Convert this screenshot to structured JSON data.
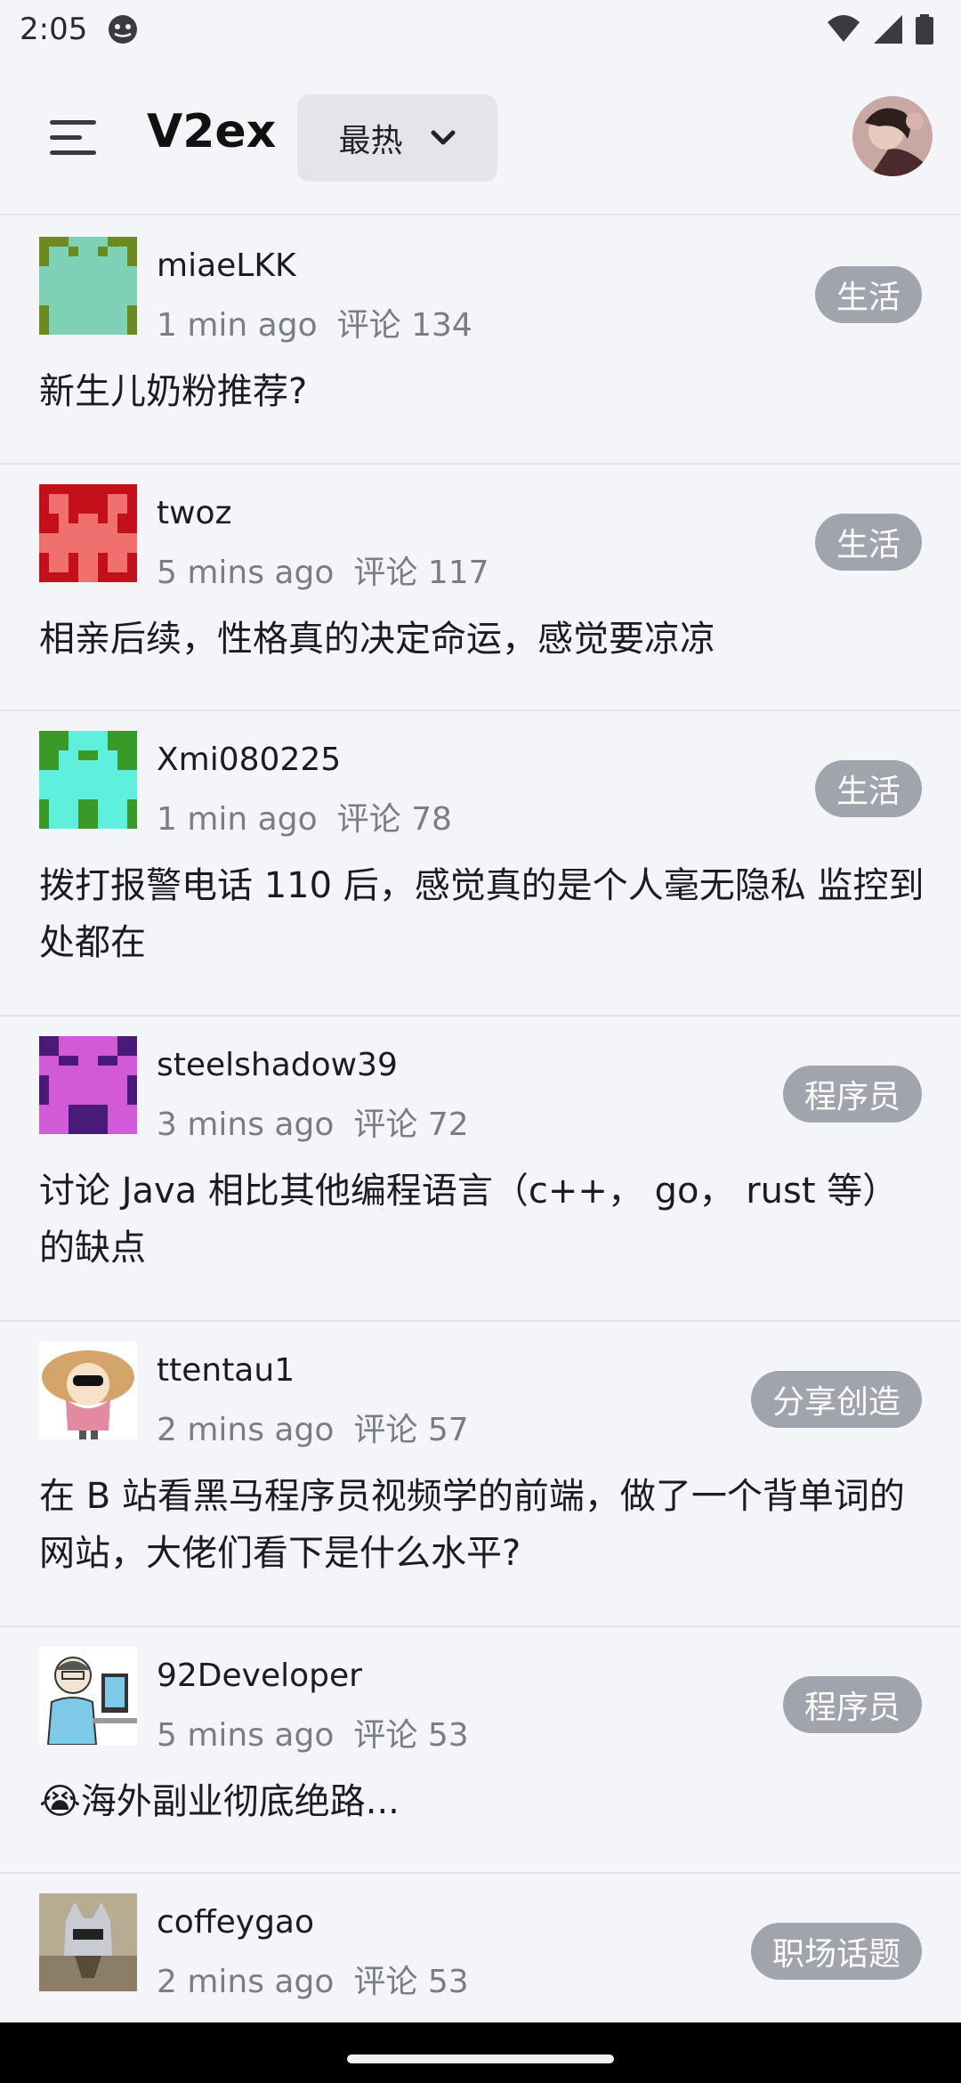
{
  "status_bar": {
    "time": "2:05",
    "icons": [
      "app-notification-icon",
      "wifi-icon",
      "signal-icon",
      "battery-icon"
    ]
  },
  "app_bar": {
    "title": "V2ex",
    "sort_label": "最热",
    "icons": [
      "menu-icon",
      "chevron-down-icon",
      "user-avatar"
    ]
  },
  "feed": [
    {
      "author": "miaeLKK",
      "time": "1 min ago",
      "comments": "评论 134",
      "node": "生活",
      "title": "新生儿奶粉推荐?",
      "avatar_color": "#6C8A1F",
      "avatar_fg": "#7ED1B5"
    },
    {
      "author": "twoz",
      "time": "5 mins ago",
      "comments": "评论 117",
      "node": "生活",
      "title": "相亲后续，性格真的决定命运，感觉要凉凉",
      "avatar_color": "#C4101A",
      "avatar_fg": "#F07070"
    },
    {
      "author": "Xmi080225",
      "time": "1 min ago",
      "comments": "评论 78",
      "node": "生活",
      "title": "拨打报警电话 110 后，感觉真的是个人毫无隐私 监控到处都在",
      "avatar_color": "#3A9A28",
      "avatar_fg": "#5EF0DC"
    },
    {
      "author": "steelshadow39",
      "time": "3 mins ago",
      "comments": "评论 72",
      "node": "程序员",
      "title": "讨论 Java 相比其他编程语言（c++， go， rust 等）的缺点",
      "avatar_color": "#4A1A78",
      "avatar_fg": "#D05AD8"
    },
    {
      "author": "ttentau1",
      "time": "2 mins ago",
      "comments": "评论 57",
      "node": "分享创造",
      "title": "在 B 站看黑马程序员视频学的前端，做了一个背单词的网站，大佬们看下是什么水平?"
    },
    {
      "author": "92Developer",
      "time": "5 mins ago",
      "comments": "评论 53",
      "node": "程序员",
      "title": "😭海外副业彻底绝路..."
    },
    {
      "author": "coffeygao",
      "time": "2 mins ago",
      "comments": "评论 53",
      "node": "职场话题",
      "title": ""
    }
  ]
}
